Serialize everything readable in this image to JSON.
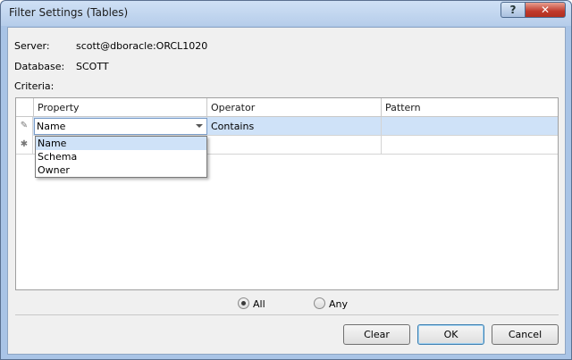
{
  "window": {
    "title": "Filter Settings (Tables)",
    "help_glyph": "?",
    "close_glyph": "✕"
  },
  "info": {
    "server_label": "Server:",
    "server_value": "scott@dboracle:ORCL1020",
    "database_label": "Database:",
    "database_value": "SCOTT",
    "criteria_label": "Criteria:"
  },
  "grid": {
    "columns": [
      "Property",
      "Operator",
      "Pattern"
    ],
    "rows": [
      {
        "marker": "✎",
        "property": "Name",
        "operator": "Contains",
        "pattern": ""
      },
      {
        "marker": "✱",
        "property": "",
        "operator": "",
        "pattern": ""
      }
    ],
    "dropdown": {
      "options": [
        "Name",
        "Schema",
        "Owner"
      ],
      "selected": "Name"
    }
  },
  "match": {
    "all_label": "All",
    "any_label": "Any",
    "selected": "All"
  },
  "buttons": {
    "clear": "Clear",
    "ok": "OK",
    "cancel": "Cancel"
  }
}
